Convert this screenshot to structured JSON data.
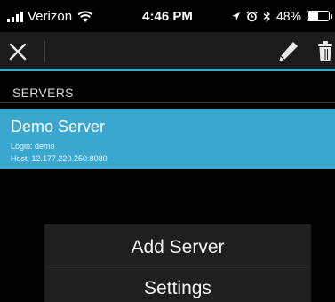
{
  "status_bar": {
    "carrier": "Verizon",
    "time": "4:46 PM",
    "battery_percent": "48%",
    "battery_level": 0.48,
    "icons": [
      "signal-icon",
      "wifi-icon",
      "location-arrow-icon",
      "alarm-icon",
      "bluetooth-icon",
      "battery-icon"
    ]
  },
  "toolbar": {
    "icons": [
      "close-icon",
      "pencil-icon",
      "trash-icon"
    ],
    "accent_color": "#3aa7cf"
  },
  "section": {
    "title": "SERVERS"
  },
  "servers": [
    {
      "name": "Demo Server",
      "login": "Login: demo",
      "host": "Host: 12.177.220.250:8080"
    }
  ],
  "menu": {
    "items": [
      {
        "label": "Add Server"
      },
      {
        "label": "Settings"
      }
    ]
  },
  "colors": {
    "accent": "#3aa7cf",
    "background": "#000000",
    "toolbar": "#1c1c1c",
    "menu": "#1f1f1f"
  }
}
